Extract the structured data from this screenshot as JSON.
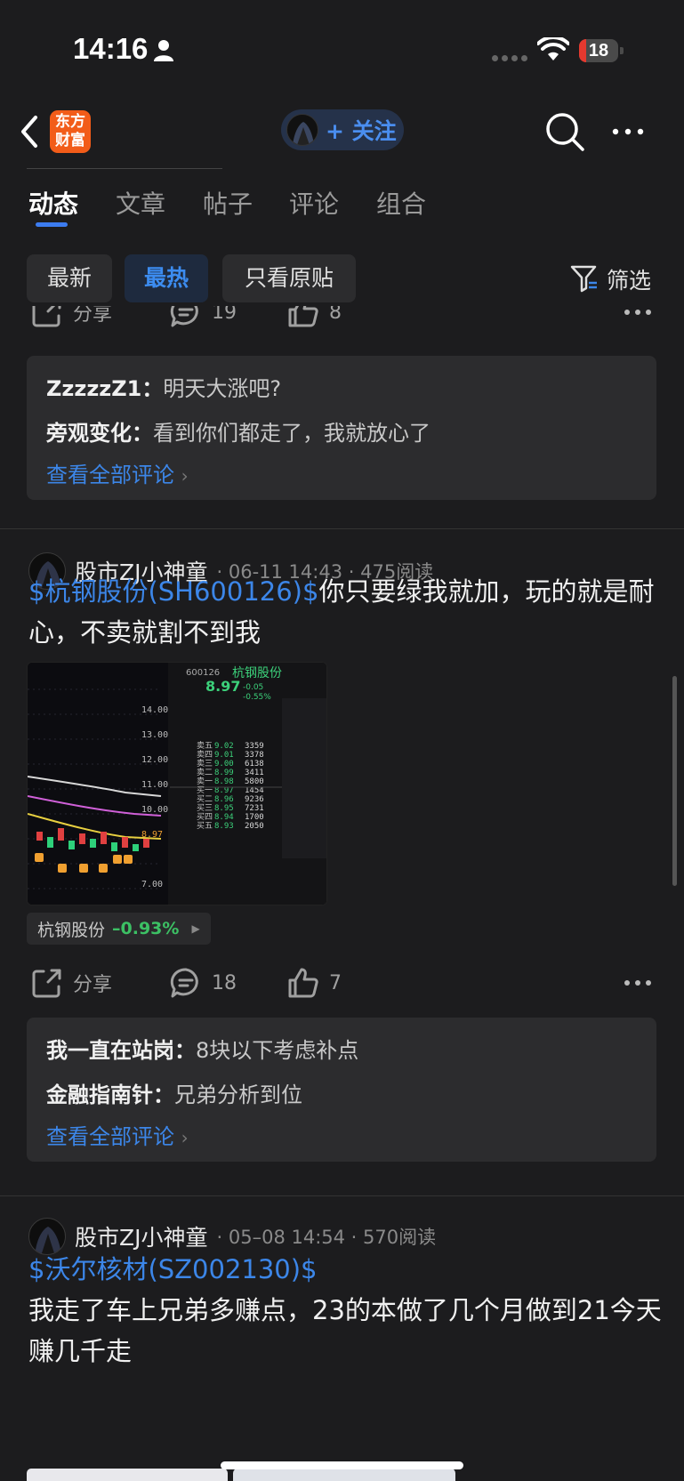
{
  "status_bar": {
    "time": "14:16",
    "battery": "18",
    "battery_level": 0.18,
    "battery_color": "#e5392f"
  },
  "nav": {
    "logo_line1": "东方",
    "logo_line2": "财富",
    "follow_label": "+ 关注",
    "logo_color": "#f25c19"
  },
  "tabs": [
    "动态",
    "文章",
    "帖子",
    "评论",
    "组合"
  ],
  "filters": {
    "chips": [
      "最新",
      "最热",
      "只看原贴"
    ],
    "active": "最热",
    "filter_label": "筛选"
  },
  "prev_post": {
    "actions": {
      "share": "分享",
      "comments": "19",
      "likes": "8"
    },
    "comments": [
      {
        "user": "ZzzzzZ1：",
        "text": "明天大涨吧?"
      },
      {
        "user": "旁观变化：",
        "text": "看到你们都走了，我就放心了"
      }
    ],
    "view_all": "查看全部评论"
  },
  "post1": {
    "author": "股市ZJ小神童",
    "date": "06-11 14:43",
    "reads": "475阅读",
    "stock_link": "$杭钢股份(SH600126)$",
    "text": "你只要绿我就加，玩的就是耐心，不卖就割不到我",
    "tag_name": "杭钢股份",
    "tag_change": "–0.93%",
    "actions": {
      "share": "分享",
      "comments": "18",
      "likes": "7"
    },
    "comments": [
      {
        "user": "我一直在站岗：",
        "text": "8块以下考虑补点"
      },
      {
        "user": "金融指南针：",
        "text": "兄弟分析到位"
      }
    ],
    "view_all": "查看全部评论",
    "image": {
      "code": "600126",
      "name": "杭钢股份",
      "price": "8.97",
      "change": "-0.05",
      "change_pct": "-0.55%",
      "price_axis": [
        "14.00",
        "13.00",
        "12.00",
        "11.00",
        "10.00",
        "8.97",
        "7.00"
      ],
      "order_book": [
        [
          "卖五",
          "9.02",
          "3359"
        ],
        [
          "卖四",
          "9.01",
          "3378"
        ],
        [
          "卖三",
          "9.00",
          "6138"
        ],
        [
          "卖二",
          "8.99",
          "3411"
        ],
        [
          "卖一",
          "8.98",
          "5800"
        ],
        [
          "买一",
          "8.97",
          "1454"
        ],
        [
          "买二",
          "8.96",
          "9236"
        ],
        [
          "买三",
          "8.95",
          "7231"
        ],
        [
          "买四",
          "8.94",
          "1700"
        ],
        [
          "买五",
          "8.93",
          "2050"
        ]
      ]
    }
  },
  "post2": {
    "author": "股市ZJ小神童",
    "date": "05–08 14:54",
    "reads": "570阅读",
    "stock_link": "$沃尔核材(SZ002130)$",
    "text": "我走了车上兄弟多赚点，23的本做了几个月做到21今天赚几千走"
  }
}
